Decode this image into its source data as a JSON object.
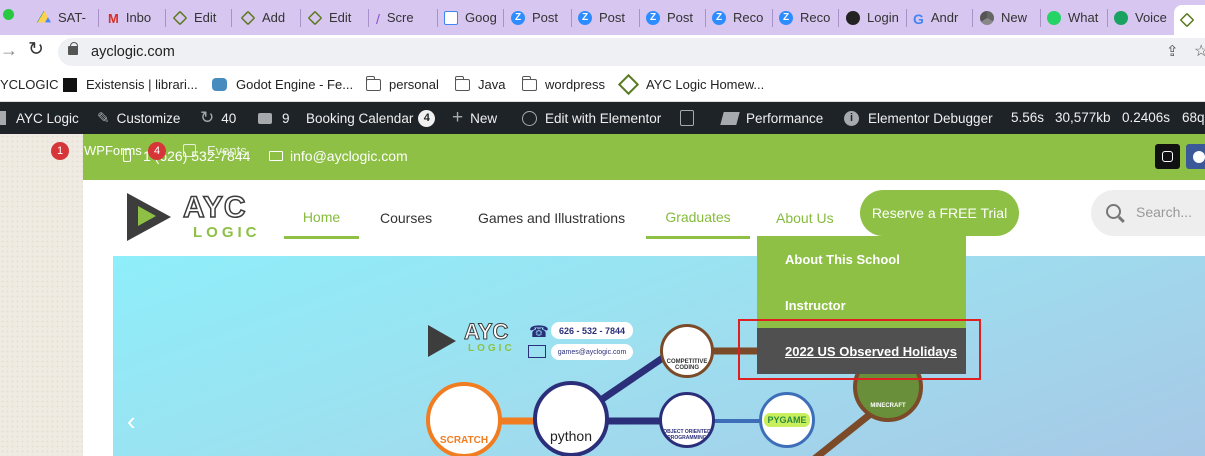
{
  "browser": {
    "tabs": [
      {
        "label": "SAT-",
        "icon": "google-drive-icon"
      },
      {
        "label": "Inbo",
        "icon": "gmail-icon"
      },
      {
        "label": "Edit",
        "icon": "ayc-logo-icon"
      },
      {
        "label": "Add",
        "icon": "ayc-logo-icon"
      },
      {
        "label": "Edit",
        "icon": "ayc-logo-icon"
      },
      {
        "label": "Scre",
        "icon": "feather-icon"
      },
      {
        "label": "Goog",
        "icon": "calendar-icon"
      },
      {
        "label": "Post",
        "icon": "zoom-icon"
      },
      {
        "label": "Post",
        "icon": "zoom-icon"
      },
      {
        "label": "Post",
        "icon": "zoom-icon"
      },
      {
        "label": "Reco",
        "icon": "zoom-icon"
      },
      {
        "label": "Reco",
        "icon": "zoom-icon"
      },
      {
        "label": "Login",
        "icon": "github-icon"
      },
      {
        "label": "Andr",
        "icon": "google-icon"
      },
      {
        "label": "New",
        "icon": "chrome-icon"
      },
      {
        "label": "What",
        "icon": "whatsapp-icon"
      },
      {
        "label": "Voice",
        "icon": "phone-icon"
      }
    ],
    "url": "ayclogic.com",
    "bookmarks": [
      {
        "label": "YCLOGIC",
        "icon": "none"
      },
      {
        "label": "Existensis | librari...",
        "icon": "existensis-icon"
      },
      {
        "label": "Godot Engine - Fe...",
        "icon": "godot-icon"
      },
      {
        "label": "personal",
        "icon": "folder-icon"
      },
      {
        "label": "Java",
        "icon": "folder-icon"
      },
      {
        "label": "wordpress",
        "icon": "folder-icon"
      },
      {
        "label": "AYC Logic Homew...",
        "icon": "ayc-logo-icon"
      }
    ]
  },
  "adminbar": {
    "site": "AYC Logic",
    "customize": "Customize",
    "updates": "40",
    "comments": "9",
    "booking": "Booking Calendar",
    "booking_count": "4",
    "new": "New",
    "elementor": "Edit with Elementor",
    "performance": "Performance",
    "debugger": "Elementor Debugger",
    "stat1": "5.56s",
    "stat2": "30,577kb",
    "stat3": "0.2406s",
    "stat4": "68q"
  },
  "sidebar": {
    "wpforms": "WPForms",
    "wpforms_count": "1",
    "events": "Events",
    "events_count": "4"
  },
  "topbar": {
    "phone": "1 (626) 532-7844",
    "email": "info@ayclogic.com"
  },
  "logo": {
    "top": "AYC",
    "bottom": "LOGIC"
  },
  "nav": {
    "home": "Home",
    "courses": "Courses",
    "games": "Games and Illustrations",
    "graduates": "Graduates",
    "about": "About Us",
    "trial": "Reserve a FREE Trial",
    "search_placeholder": "Search..."
  },
  "dropdown": {
    "item1": "About This School",
    "item2": "Instructor",
    "item3": "2022 US Observed Holidays"
  },
  "hero": {
    "logo_top": "AYC",
    "logo_bottom": "LOGIC",
    "phone": "626 - 532 - 7844",
    "email": "games@ayclogic.com",
    "nodes": [
      "COMPETITIVE CODING",
      "SCRATCH",
      "python",
      "OBJECT ORIENTED PROGRAMMING",
      "PYGAME",
      "MINECRAFT"
    ]
  }
}
